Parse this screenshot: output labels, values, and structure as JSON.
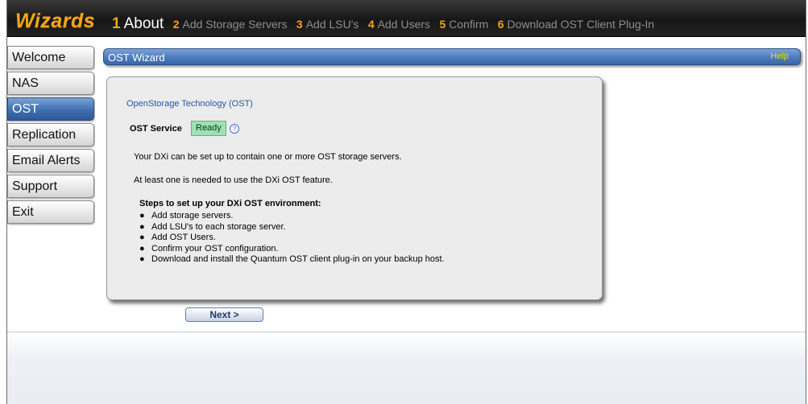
{
  "header": {
    "app_title": "Wizards",
    "steps": [
      {
        "num": "1",
        "label": "About",
        "active": true
      },
      {
        "num": "2",
        "label": "Add Storage Servers",
        "active": false
      },
      {
        "num": "3",
        "label": "Add LSU's",
        "active": false
      },
      {
        "num": "4",
        "label": "Add Users",
        "active": false
      },
      {
        "num": "5",
        "label": "Confirm",
        "active": false
      },
      {
        "num": "6",
        "label": "Download OST Client Plug-In",
        "active": false
      }
    ]
  },
  "nav": {
    "items": [
      {
        "label": "Welcome",
        "active": false
      },
      {
        "label": "NAS",
        "active": false
      },
      {
        "label": "OST",
        "active": true
      },
      {
        "label": "Replication",
        "active": false
      },
      {
        "label": "Email Alerts",
        "active": false
      },
      {
        "label": "Support",
        "active": false
      },
      {
        "label": "Exit",
        "active": false
      }
    ]
  },
  "panel": {
    "title": "OST Wizard",
    "help": "Help"
  },
  "card": {
    "title": "OpenStorage Technology (OST)",
    "service_label": "OST Service",
    "service_status": "Ready",
    "help_glyph": "?",
    "para1": "Your DXi can be set up to contain one or more OST storage servers.",
    "para2": "At least one is needed to use the DXi OST feature.",
    "steps_heading": "Steps to set up your DXi OST environment:",
    "steps": [
      "Add storage servers.",
      "Add LSU's to each storage server.",
      "Add OST Users.",
      "Confirm your OST configuration.",
      "Download and install the Quantum OST client plug-in on your backup host."
    ]
  },
  "footer": {
    "next_label": "Next >"
  },
  "colors": {
    "accent_orange": "#f2a51a",
    "nav_active_blue": "#3f6fb1",
    "help_yellow": "#e8e000",
    "status_green": "#9fe0b6"
  }
}
